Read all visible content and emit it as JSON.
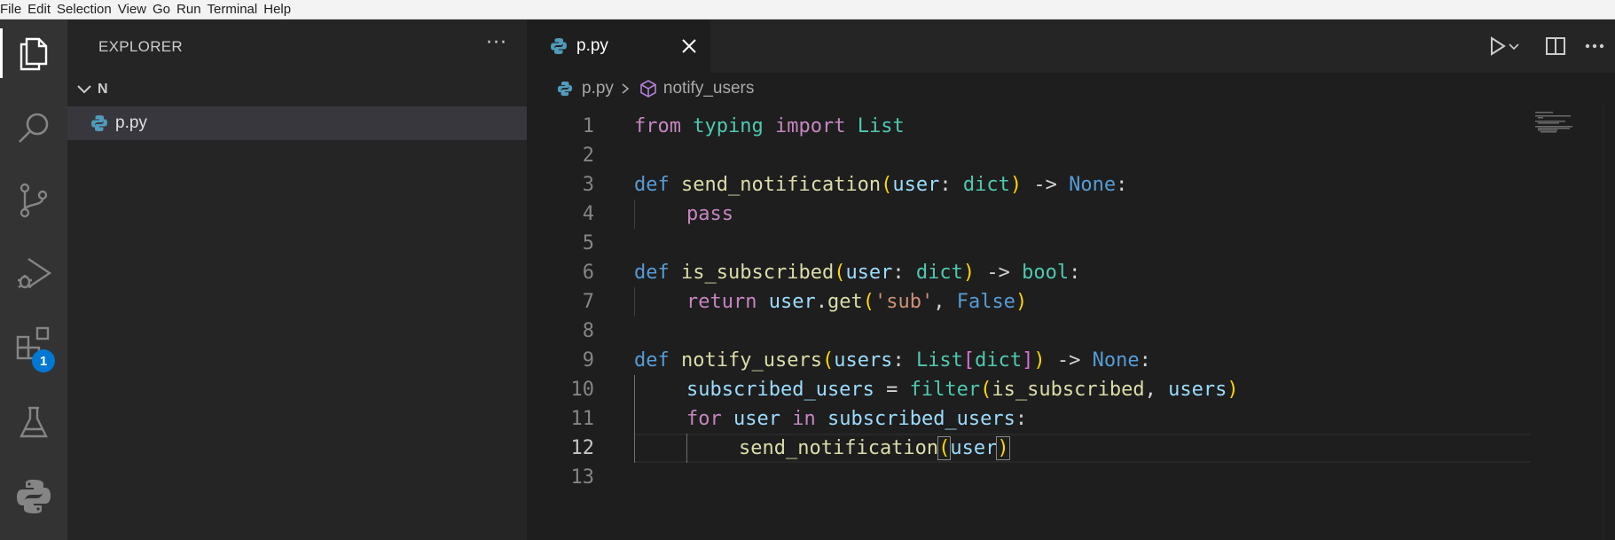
{
  "menu": [
    "File",
    "Edit",
    "Selection",
    "View",
    "Go",
    "Run",
    "Terminal",
    "Help"
  ],
  "activity": {
    "items": [
      "explorer-icon",
      "search-icon",
      "source-control-icon",
      "run-debug-icon",
      "extensions-icon",
      "testing-icon",
      "python-icon"
    ],
    "extensions_badge": "1"
  },
  "sidebar": {
    "title": "EXPLORER",
    "more": "···",
    "folder": "N",
    "files": [
      "p.py"
    ]
  },
  "editor": {
    "tab": {
      "label": "p.py",
      "close": "close-icon"
    },
    "breadcrumb": {
      "file": "p.py",
      "symbol": "notify_users"
    },
    "current_line": 12,
    "lines": [
      {
        "n": "1"
      },
      {
        "n": "2"
      },
      {
        "n": "3"
      },
      {
        "n": "4"
      },
      {
        "n": "5"
      },
      {
        "n": "6"
      },
      {
        "n": "7"
      },
      {
        "n": "8"
      },
      {
        "n": "9"
      },
      {
        "n": "10"
      },
      {
        "n": "11"
      },
      {
        "n": "12"
      },
      {
        "n": "13"
      }
    ]
  },
  "code": {
    "l1": [
      "from",
      " ",
      "typing",
      " ",
      "import",
      " ",
      "List"
    ],
    "l3": [
      "def",
      " ",
      "send_notification",
      "(",
      "user",
      ": ",
      "dict",
      ")",
      " -> ",
      "None",
      ":"
    ],
    "l4": [
      "pass"
    ],
    "l6": [
      "def",
      " ",
      "is_subscribed",
      "(",
      "user",
      ": ",
      "dict",
      ")",
      " -> ",
      "bool",
      ":"
    ],
    "l7": [
      "return",
      " ",
      "user",
      ".",
      "get",
      "(",
      "'sub'",
      ", ",
      "False",
      ")"
    ],
    "l9": [
      "def",
      " ",
      "notify_users",
      "(",
      "users",
      ": ",
      "List",
      "[",
      "dict",
      "]",
      ")",
      " -> ",
      "None",
      ":"
    ],
    "l10": [
      "subscribed_users",
      " = ",
      "filter",
      "(",
      "is_subscribed",
      ", ",
      "users",
      ")"
    ],
    "l11": [
      "for",
      " ",
      "user",
      " ",
      "in",
      " ",
      "subscribed_users",
      ":"
    ],
    "l12": [
      "send_notification",
      "(",
      "user",
      ")"
    ]
  }
}
